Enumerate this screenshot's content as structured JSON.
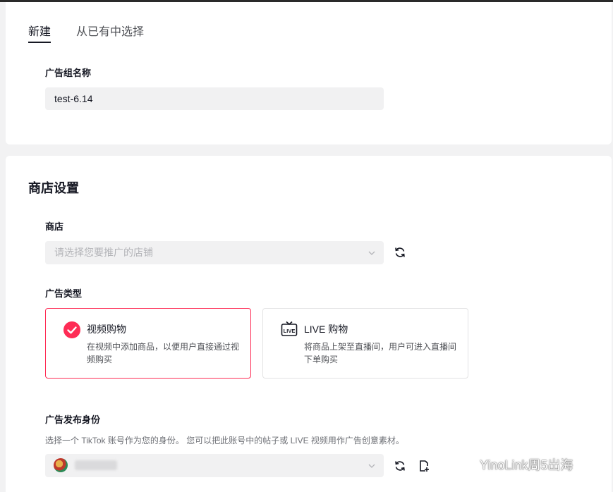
{
  "tabs": {
    "new_label": "新建",
    "existing_label": "从已有中选择"
  },
  "ad_group": {
    "label": "广告组名称",
    "value": "test-6.14"
  },
  "shop_settings": {
    "title": "商店设置",
    "shop_label": "商店",
    "shop_placeholder": "请选择您要推广的店铺",
    "ad_type_label": "广告类型",
    "ad_types": [
      {
        "title": "视频购物",
        "description": "在视频中添加商品，以便用户直接通过视频购买",
        "selected": true,
        "icon": "check-icon"
      },
      {
        "title": "LIVE 购物",
        "description": "将商品上架至直播间，用户可进入直播间下单购买",
        "selected": false,
        "icon": "live-icon"
      }
    ],
    "identity_label": "广告发布身份",
    "identity_helper": "选择一个 TikTok 账号作为您的身份。 您可以把此账号中的帖子或 LIVE 视频用作广告创意素材。"
  },
  "watermark_brand": "YinoLink周5出海",
  "colors": {
    "accent": "#fe2c55",
    "text": "#161823",
    "input_bg": "#f1f1f2"
  }
}
